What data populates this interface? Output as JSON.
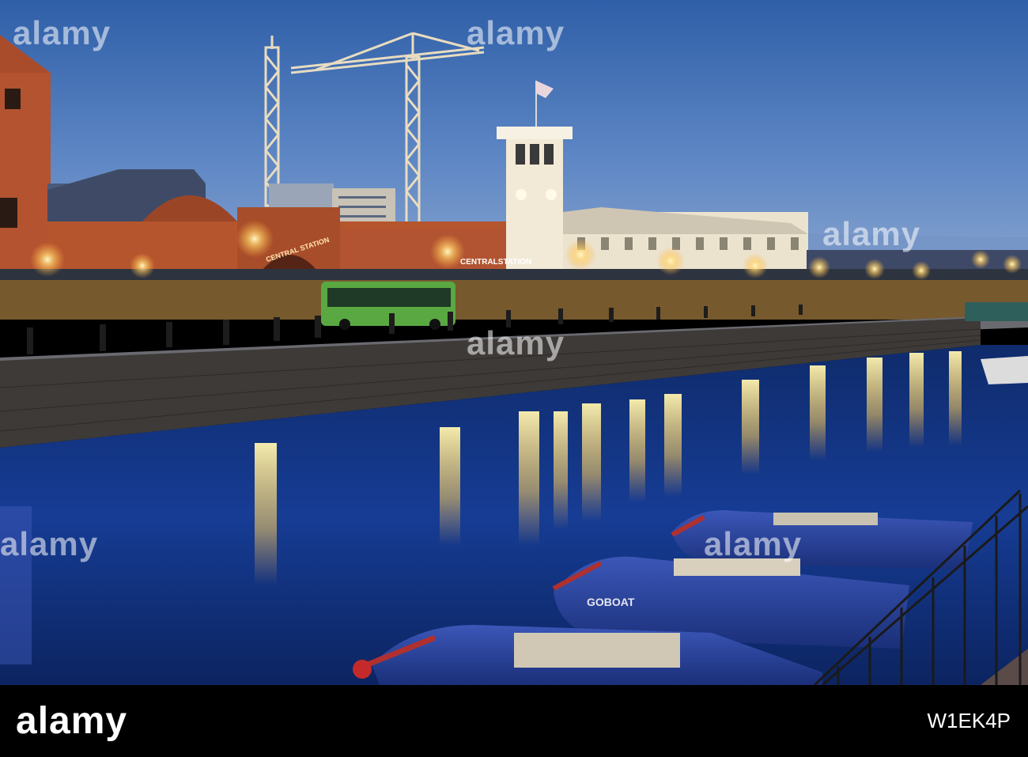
{
  "photo": {
    "station_sign": "CENTRALSTATION",
    "arch_sign": "CENTRAL STATION",
    "boat_name": "GOBOAT"
  },
  "watermark": {
    "text": "alamy"
  },
  "footer": {
    "logo": "alamy",
    "image_id": "W1EK4P"
  }
}
